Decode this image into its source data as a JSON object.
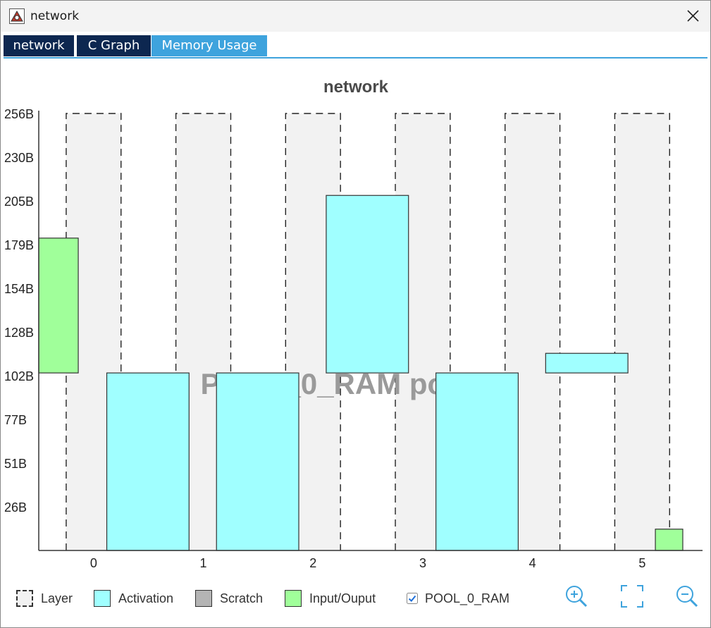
{
  "window": {
    "title": "network"
  },
  "tabs": [
    {
      "label": "network"
    },
    {
      "label": "C Graph"
    },
    {
      "label": "Memory Usage",
      "active": true
    }
  ],
  "colors": {
    "tab_dark": "#0d2750",
    "tab_active": "#3ea3dd",
    "activation": "#a0ffff",
    "input_output": "#a0ff9a",
    "scratch": "#b4b4b4",
    "layer_bg": "#f2f2f2",
    "accent": "#3ea3dd"
  },
  "chart_data": {
    "type": "bar",
    "title": "network",
    "watermark": "POOL_0_RAM pool",
    "xlabel": "",
    "ylabel": "",
    "x_ticks": [
      "0",
      "1",
      "2",
      "3",
      "4",
      "5"
    ],
    "y_ticks": [
      "26B",
      "51B",
      "77B",
      "102B",
      "128B",
      "154B",
      "179B",
      "205B",
      "230B",
      "256B"
    ],
    "y_tick_values": [
      25.6,
      51.2,
      76.8,
      102.4,
      128,
      153.6,
      179.2,
      204.8,
      230.4,
      256
    ],
    "ylim": [
      0,
      256
    ],
    "xlim": [
      -0.5,
      5.55
    ],
    "layers": [
      {
        "layer": 0,
        "start": -0.25,
        "end": 0.25,
        "top": 256
      },
      {
        "layer": 1,
        "start": 0.75,
        "end": 1.25,
        "top": 256
      },
      {
        "layer": 2,
        "start": 1.75,
        "end": 2.25,
        "top": 256
      },
      {
        "layer": 3,
        "start": 2.75,
        "end": 3.25,
        "top": 256
      },
      {
        "layer": 4,
        "start": 3.75,
        "end": 4.25,
        "top": 256
      },
      {
        "layer": 5,
        "start": 4.75,
        "end": 5.25,
        "top": 256
      }
    ],
    "buffers": [
      {
        "kind": "input_output",
        "start": -0.5,
        "end": -0.14,
        "bottom": 104,
        "top": 183
      },
      {
        "kind": "activation",
        "start": 0.12,
        "end": 0.87,
        "bottom": 0,
        "top": 104
      },
      {
        "kind": "activation",
        "start": 1.12,
        "end": 1.87,
        "bottom": 0,
        "top": 104
      },
      {
        "kind": "activation",
        "start": 2.12,
        "end": 2.87,
        "bottom": 104,
        "top": 208
      },
      {
        "kind": "activation",
        "start": 3.12,
        "end": 3.87,
        "bottom": 0,
        "top": 104
      },
      {
        "kind": "activation",
        "start": 4.12,
        "end": 4.87,
        "bottom": 104,
        "top": 115.5
      },
      {
        "kind": "input_output",
        "start": 5.12,
        "end": 5.37,
        "bottom": 0,
        "top": 12.5
      }
    ]
  },
  "legend": {
    "layer": "Layer",
    "activation": "Activation",
    "scratch": "Scratch",
    "input_output": "Input/Ouput",
    "pool": "POOL_0_RAM",
    "pool_checked": true
  },
  "toolbar": {
    "zoom_in": "zoom-in-icon",
    "fit": "fit-icon",
    "zoom_out": "zoom-out-icon"
  }
}
